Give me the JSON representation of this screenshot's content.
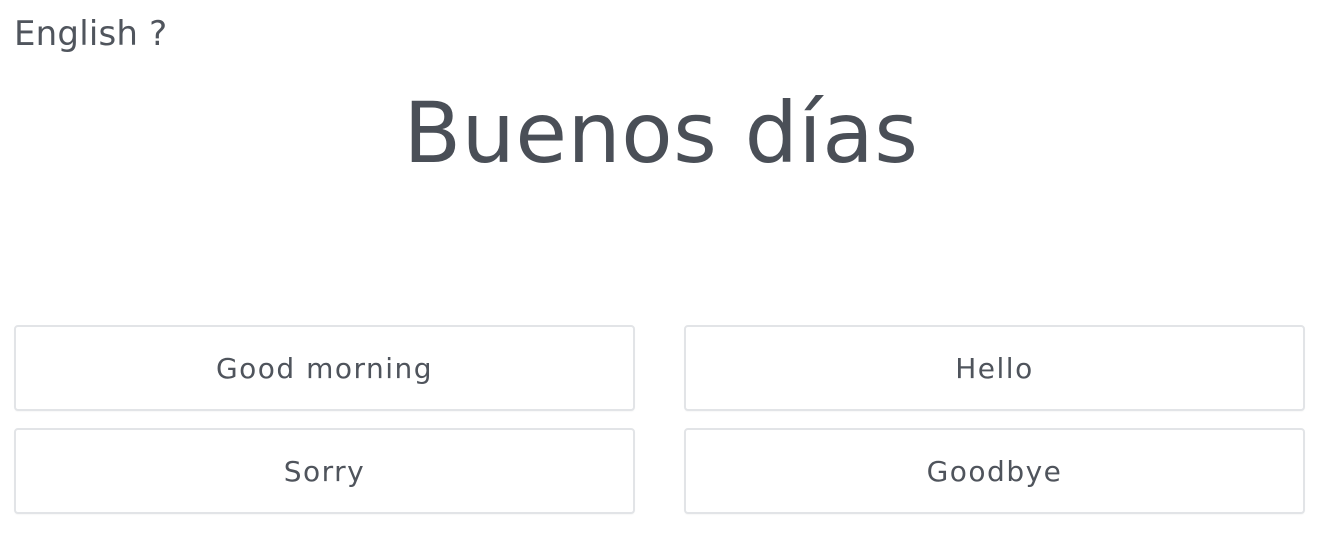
{
  "prompt": {
    "label": "English ?"
  },
  "question": {
    "phrase": "Buenos días"
  },
  "answers": [
    {
      "label": "Good morning"
    },
    {
      "label": "Hello"
    },
    {
      "label": "Sorry"
    },
    {
      "label": "Goodbye"
    }
  ],
  "colors": {
    "text": "#4a4f57",
    "button_border": "#e2e4e7",
    "background": "#ffffff"
  }
}
